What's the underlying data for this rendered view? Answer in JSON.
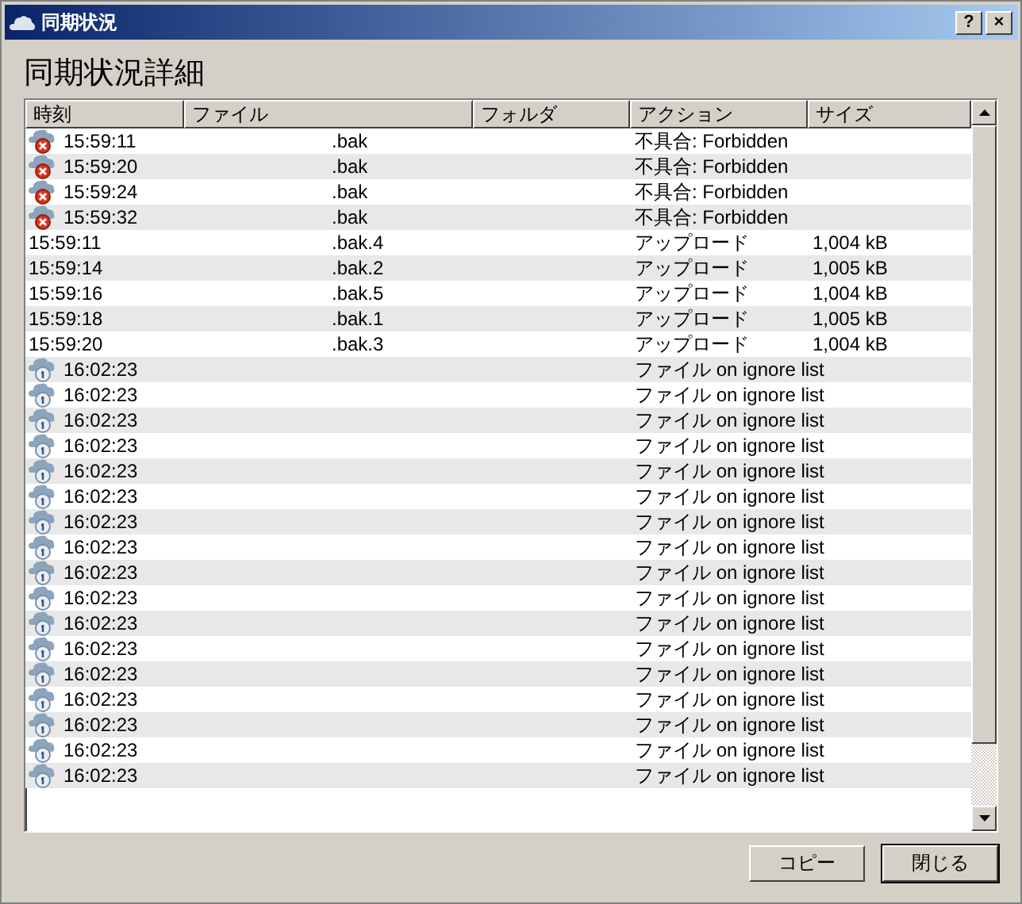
{
  "window": {
    "title": "同期状況",
    "buttons": [
      "?",
      "×"
    ]
  },
  "heading": "同期状況詳細",
  "table": {
    "columns": [
      "時刻",
      "ファイル",
      "フォルダ",
      "アクション",
      "サイズ"
    ],
    "rows": [
      {
        "kind": "error",
        "time": "15:59:11",
        "file": ".bak",
        "folder": "",
        "action": "不具合: Forbidden",
        "size": ""
      },
      {
        "kind": "error",
        "time": "15:59:20",
        "file": ".bak",
        "folder": "",
        "action": "不具合: Forbidden",
        "size": ""
      },
      {
        "kind": "error",
        "time": "15:59:24",
        "file": ".bak",
        "folder": "",
        "action": "不具合: Forbidden",
        "size": ""
      },
      {
        "kind": "error",
        "time": "15:59:32",
        "file": ".bak",
        "folder": "",
        "action": "不具合: Forbidden",
        "size": ""
      },
      {
        "kind": "plain",
        "time": "15:59:11",
        "file": ".bak.4",
        "folder": "",
        "action": "アップロード",
        "size": "1,004 kB"
      },
      {
        "kind": "plain",
        "time": "15:59:14",
        "file": ".bak.2",
        "folder": "",
        "action": "アップロード",
        "size": "1,005 kB"
      },
      {
        "kind": "plain",
        "time": "15:59:16",
        "file": ".bak.5",
        "folder": "",
        "action": "アップロード",
        "size": "1,004 kB"
      },
      {
        "kind": "plain",
        "time": "15:59:18",
        "file": ".bak.1",
        "folder": "",
        "action": "アップロード",
        "size": "1,005 kB"
      },
      {
        "kind": "plain",
        "time": "15:59:20",
        "file": ".bak.3",
        "folder": "",
        "action": "アップロード",
        "size": "1,004 kB"
      },
      {
        "kind": "info",
        "time": "16:02:23",
        "file": "",
        "folder": "",
        "action": "ファイル on ignore list",
        "size": ""
      },
      {
        "kind": "info",
        "time": "16:02:23",
        "file": "",
        "folder": "",
        "action": "ファイル on ignore list",
        "size": ""
      },
      {
        "kind": "info",
        "time": "16:02:23",
        "file": "",
        "folder": "",
        "action": "ファイル on ignore list",
        "size": ""
      },
      {
        "kind": "info",
        "time": "16:02:23",
        "file": "",
        "folder": "",
        "action": "ファイル on ignore list",
        "size": ""
      },
      {
        "kind": "info",
        "time": "16:02:23",
        "file": "",
        "folder": "",
        "action": "ファイル on ignore list",
        "size": ""
      },
      {
        "kind": "info",
        "time": "16:02:23",
        "file": "",
        "folder": "",
        "action": "ファイル on ignore list",
        "size": ""
      },
      {
        "kind": "info",
        "time": "16:02:23",
        "file": "",
        "folder": "",
        "action": "ファイル on ignore list",
        "size": ""
      },
      {
        "kind": "info",
        "time": "16:02:23",
        "file": "",
        "folder": "",
        "action": "ファイル on ignore list",
        "size": ""
      },
      {
        "kind": "info",
        "time": "16:02:23",
        "file": "",
        "folder": "",
        "action": "ファイル on ignore list",
        "size": ""
      },
      {
        "kind": "info",
        "time": "16:02:23",
        "file": "",
        "folder": "",
        "action": "ファイル on ignore list",
        "size": ""
      },
      {
        "kind": "info",
        "time": "16:02:23",
        "file": "",
        "folder": "",
        "action": "ファイル on ignore list",
        "size": ""
      },
      {
        "kind": "info",
        "time": "16:02:23",
        "file": "",
        "folder": "",
        "action": "ファイル on ignore list",
        "size": ""
      },
      {
        "kind": "info",
        "time": "16:02:23",
        "file": "",
        "folder": "",
        "action": "ファイル on ignore list",
        "size": ""
      },
      {
        "kind": "info",
        "time": "16:02:23",
        "file": "",
        "folder": "",
        "action": "ファイル on ignore list",
        "size": ""
      },
      {
        "kind": "info",
        "time": "16:02:23",
        "file": "",
        "folder": "",
        "action": "ファイル on ignore list",
        "size": ""
      },
      {
        "kind": "info",
        "time": "16:02:23",
        "file": "",
        "folder": "",
        "action": "ファイル on ignore list",
        "size": ""
      },
      {
        "kind": "info",
        "time": "16:02:23",
        "file": "",
        "folder": "",
        "action": "ファイル on ignore list",
        "size": ""
      }
    ]
  },
  "buttons": [
    "コピー",
    "閉じる"
  ]
}
